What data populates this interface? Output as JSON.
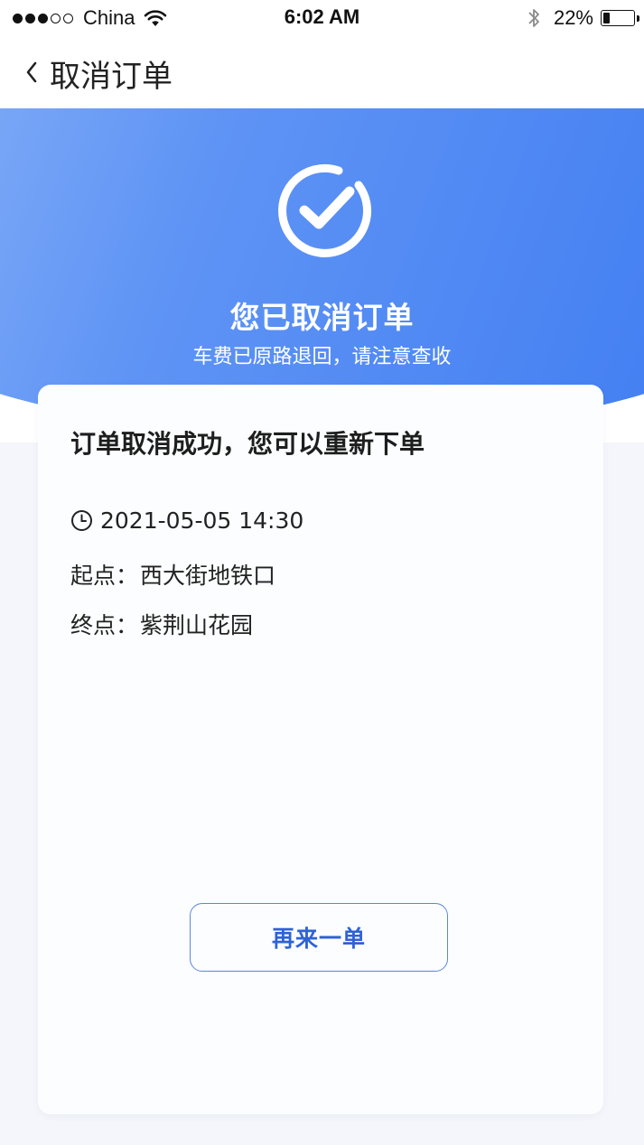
{
  "status_bar": {
    "carrier": "China",
    "time": "6:02 AM",
    "battery_percent": "22%",
    "battery_level": 0.22,
    "signal_bars_filled": 3,
    "signal_bars_total": 5
  },
  "nav": {
    "back_icon": "chevron-left-icon",
    "title": "取消订单"
  },
  "hero": {
    "icon": "check-circle-icon",
    "title": "您已取消订单",
    "subtitle": "车费已原路退回，请注意查收",
    "gradient_colors": [
      "#8fb6f8",
      "#3f7cf2"
    ]
  },
  "card": {
    "title": "订单取消成功，您可以重新下单",
    "time_icon": "clock-icon",
    "datetime": "2021-05-05 14:30",
    "start_label": "起点：",
    "start_value": "西大街地铁口",
    "end_label": "终点：",
    "end_value": "紫荆山花园",
    "reorder_button": "再来一单"
  },
  "colors": {
    "accent": "#2e63d6",
    "button_border": "#5a86e0",
    "page_bg": "#f4f6fb"
  }
}
